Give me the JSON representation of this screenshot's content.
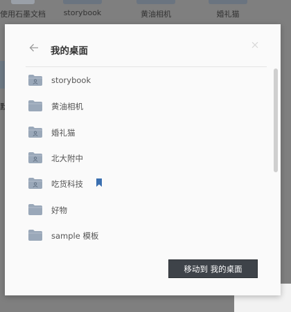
{
  "background": {
    "doc_items": [
      "使用石墨文档",
      "storybook",
      "黄油相机",
      "婚礼猫"
    ],
    "left_fragment": "默"
  },
  "dialog": {
    "title": "我的桌面",
    "back_icon": "arrow-left-icon",
    "close_icon": "close-icon",
    "folders": [
      {
        "label": "storybook",
        "shared": true,
        "bookmarked": false
      },
      {
        "label": "黄油相机",
        "shared": false,
        "bookmarked": false
      },
      {
        "label": "婚礼猫",
        "shared": true,
        "bookmarked": false
      },
      {
        "label": "北大附中",
        "shared": true,
        "bookmarked": false
      },
      {
        "label": "吃货科技",
        "shared": true,
        "bookmarked": true
      },
      {
        "label": "好物",
        "shared": false,
        "bookmarked": false
      },
      {
        "label": "sample 模板",
        "shared": false,
        "bookmarked": false
      }
    ],
    "move_button": "移动到 我的桌面"
  },
  "colors": {
    "folder": "#9aa8b9",
    "bookmark": "#3a6fb0",
    "button": "#3e4349"
  }
}
